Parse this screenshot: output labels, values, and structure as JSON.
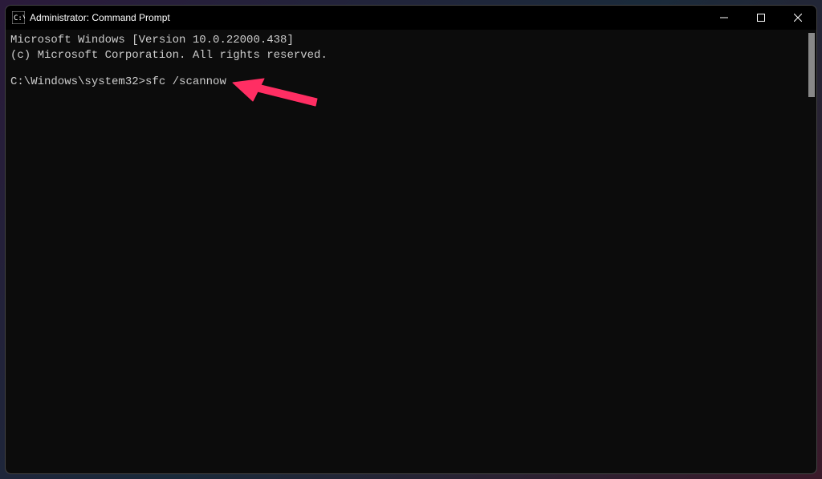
{
  "window": {
    "title": "Administrator: Command Prompt"
  },
  "terminal": {
    "line1": "Microsoft Windows [Version 10.0.22000.438]",
    "line2": "(c) Microsoft Corporation. All rights reserved.",
    "prompt": "C:\\Windows\\system32>",
    "command": "sfc /scannow"
  },
  "annotation": {
    "arrow_color": "#ff2e63"
  }
}
